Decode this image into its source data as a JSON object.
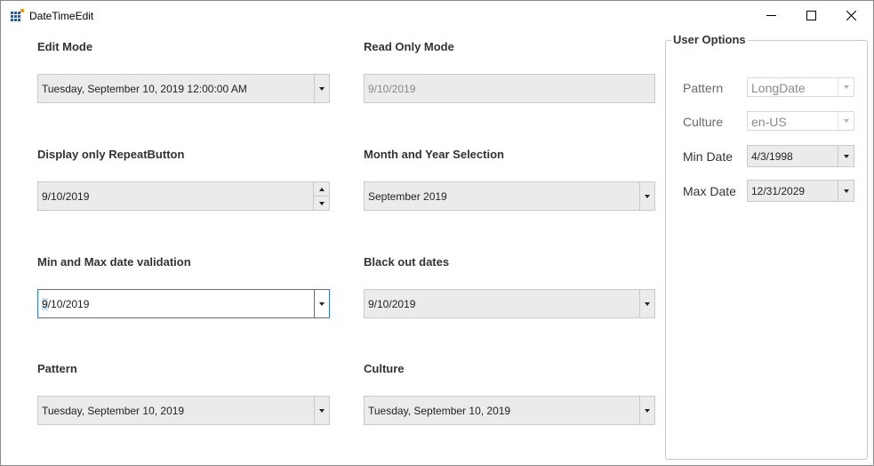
{
  "window": {
    "title": "DateTimeEdit"
  },
  "controls": {
    "edit_mode": {
      "label": "Edit Mode",
      "value": "Tuesday, September 10, 2019 12:00:00 AM"
    },
    "read_only": {
      "label": "Read Only Mode",
      "value": "9/10/2019"
    },
    "repeat_button": {
      "label": "Display only RepeatButton",
      "value": "9/10/2019"
    },
    "month_year": {
      "label": "Month and Year Selection",
      "value": "September 2019"
    },
    "min_max": {
      "label": "Min and Max date validation",
      "value_first": "9",
      "value_rest": "/10/2019"
    },
    "blackout": {
      "label": "Black out dates",
      "value": "9/10/2019"
    },
    "pattern": {
      "label": "Pattern",
      "value": "Tuesday, September 10, 2019"
    },
    "culture": {
      "label": "Culture",
      "value": "Tuesday, September 10, 2019"
    }
  },
  "user_options": {
    "title": "User Options",
    "pattern": {
      "label": "Pattern",
      "value": "LongDate"
    },
    "culture": {
      "label": "Culture",
      "value": "en-US"
    },
    "min_date": {
      "label": "Min Date",
      "value": "4/3/1998"
    },
    "max_date": {
      "label": "Max Date",
      "value": "12/31/2029"
    }
  },
  "colors": {
    "focus_border": "#2b7bd6",
    "field_bg": "#ebebeb",
    "selection": "#cce4f7"
  }
}
